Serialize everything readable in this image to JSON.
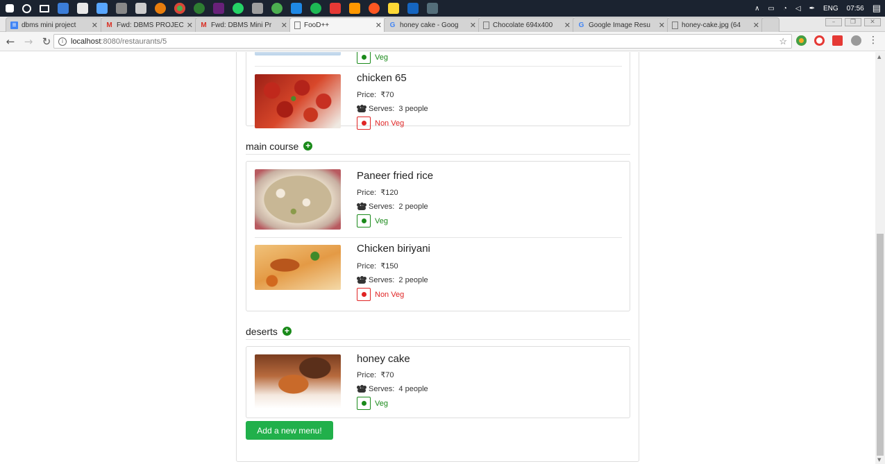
{
  "taskbar": {
    "language": "ENG",
    "time": "07:56"
  },
  "tabs": [
    {
      "label": "dbms mini project",
      "icon": "docs-icon",
      "active": false
    },
    {
      "label": "Fwd: DBMS PROJEC",
      "icon": "gmail-icon",
      "active": false
    },
    {
      "label": "Fwd: DBMS Mini Pr",
      "icon": "gmail-icon",
      "active": false
    },
    {
      "label": "FooD++",
      "icon": "page-icon",
      "active": true
    },
    {
      "label": "honey cake - Goog",
      "icon": "google-icon",
      "active": false
    },
    {
      "label": "Chocolate 694x400",
      "icon": "page-icon",
      "active": false
    },
    {
      "label": "Google Image Resu",
      "icon": "google-icon",
      "active": false
    },
    {
      "label": "honey-cake.jpg (64",
      "icon": "page-icon",
      "active": false
    }
  ],
  "address": {
    "host": "localhost",
    "path": ":8080/restaurants/5"
  },
  "menu": {
    "sections": [
      {
        "title": "",
        "items": [
          {
            "name": "",
            "price": "",
            "serves": "",
            "type": "Veg",
            "image": "partial-dish"
          },
          {
            "name": "chicken 65",
            "price_label": "Price:",
            "price": "₹70",
            "serves_label": "Serves:",
            "serves": "3 people",
            "type": "Non Veg",
            "image": "chicken-65"
          }
        ]
      },
      {
        "title": "main course",
        "items": [
          {
            "name": "Paneer fried rice",
            "price_label": "Price:",
            "price": "₹120",
            "serves_label": "Serves:",
            "serves": "2 people",
            "type": "Veg",
            "image": "fried-rice"
          },
          {
            "name": "Chicken biriyani",
            "price_label": "Price:",
            "price": "₹150",
            "serves_label": "Serves:",
            "serves": "2 people",
            "type": "Non Veg",
            "image": "biriyani"
          }
        ]
      },
      {
        "title": "deserts",
        "items": [
          {
            "name": "honey cake",
            "price_label": "Price:",
            "price": "₹70",
            "serves_label": "Serves:",
            "serves": "4 people",
            "type": "Veg",
            "image": "honey-cake"
          }
        ]
      }
    ],
    "add_button": "Add a new menu!"
  },
  "colors": {
    "veg": "#1a8a1a",
    "nonveg": "#e02424",
    "button": "#21b04b"
  }
}
